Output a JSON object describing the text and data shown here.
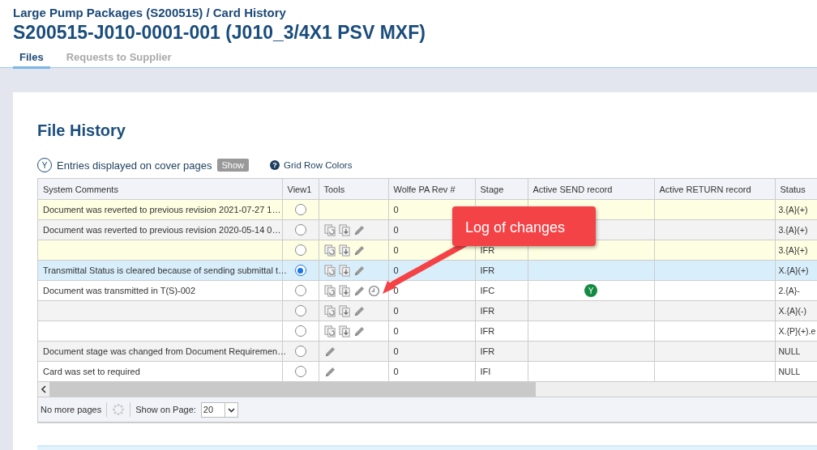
{
  "breadcrumb": "Large Pump Packages (S200515) / Card History",
  "title": "S200515-J010-0001-001 (J010_3/4X1 PSV MXF)",
  "tabs": [
    {
      "label": "Files",
      "selected": true
    },
    {
      "label": "Requests to Supplier",
      "selected": false
    }
  ],
  "section_title": "File History",
  "filter": {
    "icon_letter": "Y",
    "label": "Entries displayed on cover pages",
    "button": "Show",
    "help_icon": "?",
    "help_link": "Grid Row Colors"
  },
  "table": {
    "columns": [
      "System Comments",
      "View1",
      "Tools",
      "Wolfe PA Rev #",
      "Stage",
      "Active SEND record",
      "Active RETURN record",
      "Status"
    ],
    "rows": [
      {
        "comment": "Document was reverted to previous revision 2021-07-27 1…",
        "selected": false,
        "tools": [],
        "rev": "0",
        "status": "3.{A}(+)",
        "color": "#fefee2"
      },
      {
        "comment": "Document was reverted to previous revision 2020-05-14 0…",
        "selected": false,
        "tools": [
          {
            "kind": "copy"
          },
          {
            "kind": "download"
          },
          {
            "kind": "edit"
          }
        ],
        "rev": "0",
        "status": "3.{A}(+)",
        "color": "#f3f3f3"
      },
      {
        "selected": false,
        "tools": [
          {
            "kind": "copy"
          },
          {
            "kind": "download"
          },
          {
            "kind": "edit"
          }
        ],
        "rev": "0",
        "stage": "IFR",
        "status": "3.{A}(+)",
        "color": "#fefee2"
      },
      {
        "comment": "Transmittal Status is cleared because of sending submittal t…",
        "selected": true,
        "tools": [
          {
            "kind": "copy"
          },
          {
            "kind": "download"
          },
          {
            "kind": "edit"
          }
        ],
        "rev": "0",
        "stage": "IFR",
        "status": "X.{A}(+)",
        "color": "#d9eefb"
      },
      {
        "comment": "Document was transmitted in T(S)-002",
        "selected": false,
        "tools": [
          {
            "kind": "copy"
          },
          {
            "kind": "download"
          },
          {
            "kind": "edit"
          },
          {
            "kind": "history"
          }
        ],
        "rev": "0",
        "stage": "IFC",
        "send_badge": "Y",
        "status": "2.{A}-",
        "color": "#ffffff"
      },
      {
        "selected": false,
        "tools": [
          {
            "kind": "copy"
          },
          {
            "kind": "download"
          },
          {
            "kind": "edit"
          }
        ],
        "rev": "0",
        "stage": "IFR",
        "status": "X.{A}(-)",
        "color": "#f3f3f3"
      },
      {
        "selected": false,
        "tools": [
          {
            "kind": "copy"
          },
          {
            "kind": "download"
          },
          {
            "kind": "edit"
          }
        ],
        "rev": "0",
        "stage": "IFR",
        "status": "X.{P}(+).e",
        "color": "#ffffff"
      },
      {
        "comment": "Document stage was changed from Document Requiremen…",
        "selected": false,
        "tools": [
          {
            "kind": "edit"
          }
        ],
        "rev": "0",
        "stage": "IFR",
        "status": "NULL",
        "color": "#f3f3f3"
      },
      {
        "comment": "Card was set to required",
        "selected": false,
        "tools": [
          {
            "kind": "edit"
          }
        ],
        "rev": "0",
        "stage": "IFI",
        "status": "NULL",
        "color": "#ffffff"
      }
    ]
  },
  "pager": {
    "label": "No more pages",
    "page_size_label": "Show on Page:",
    "page_size": "20"
  },
  "callout": "Log of changes"
}
